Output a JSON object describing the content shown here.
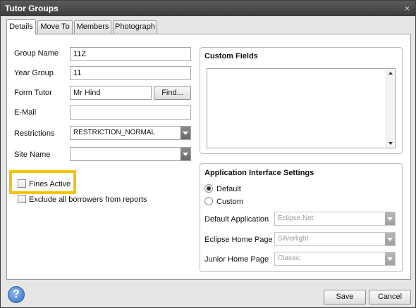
{
  "window": {
    "title": "Tutor Groups",
    "close_glyph": "×"
  },
  "tabs": [
    {
      "label": "Details",
      "active": true
    },
    {
      "label": "Move To",
      "active": false
    },
    {
      "label": "Members",
      "active": false
    },
    {
      "label": "Photograph",
      "active": false
    }
  ],
  "form": {
    "group_name": {
      "label": "Group Name",
      "value": "11Z"
    },
    "year_group": {
      "label": "Year Group",
      "value": "11"
    },
    "form_tutor": {
      "label": "Form Tutor",
      "value": "Mr Hind",
      "find_label": "Find..."
    },
    "email": {
      "label": "E-Mail",
      "value": ""
    },
    "restrictions": {
      "label": "Restrictions",
      "value": "RESTRICTION_NORMAL"
    },
    "site_name": {
      "label": "Site Name",
      "value": ""
    }
  },
  "checkboxes": {
    "fines_active": {
      "label": "Fines Active",
      "checked": false
    },
    "exclude_borrowers": {
      "label": "Exclude all borrowers from reports",
      "checked": false
    }
  },
  "custom_fields": {
    "title": "Custom Fields"
  },
  "app_interface": {
    "title": "Application Interface Settings",
    "radio_default": {
      "label": "Default",
      "checked": true
    },
    "radio_custom": {
      "label": "Custom",
      "checked": false
    },
    "default_application": {
      "label": "Default Application",
      "value": "Eclipse.Net"
    },
    "eclipse_home_page": {
      "label": "Eclipse Home Page",
      "value": "Silverlight"
    },
    "junior_home_page": {
      "label": "Junior Home Page",
      "value": "Classic"
    }
  },
  "footer": {
    "save_label": "Save",
    "cancel_label": "Cancel",
    "help_glyph": "?"
  },
  "colors": {
    "highlight": "#f5c400",
    "titlebar": "#4a4a4a"
  }
}
